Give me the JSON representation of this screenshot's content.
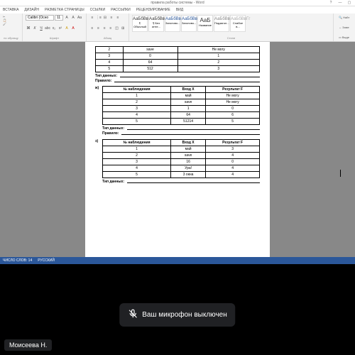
{
  "title": "правила работы системы - Word",
  "ribbonTabs": [
    "ВСТАВКА",
    "ДИЗАЙН",
    "РАЗМЕТКА СТРАНИЦЫ",
    "ССЫЛКИ",
    "РАССЫЛКИ",
    "РЕЦЕНЗИРОВАНИЕ",
    "ВИД"
  ],
  "font": {
    "name": "Calibri (Осно",
    "size": "11"
  },
  "groups": {
    "clipboard": "по образцу",
    "font": "Шрифт",
    "para": "Абзац",
    "styles": "Стили"
  },
  "styles": [
    {
      "t": "АаБбВвГг",
      "n": "¶ Обычный"
    },
    {
      "t": "АаБбВвГг",
      "n": "¶ Без инте..."
    },
    {
      "t": "АаБбВв",
      "n": "Заголово..."
    },
    {
      "t": "АаБбВвГ",
      "n": "Заголово..."
    },
    {
      "t": "АаБ",
      "n": "Название"
    },
    {
      "t": "АаБбВвГг",
      "n": "Подзагол..."
    },
    {
      "t": "АаБбВвГг",
      "n": "Слабое в..."
    }
  ],
  "editing": [
    "Найт",
    "Заме",
    "Выде"
  ],
  "doc": {
    "headers": {
      "num": "№ наблюдения",
      "x": "Вход X",
      "f": "Результат F"
    },
    "labels": {
      "type": "Тип данных:",
      "rule": "Правило:"
    },
    "table_top": [
      [
        "2",
        "save",
        "Не могу"
      ],
      [
        "3",
        "0",
        "1"
      ],
      [
        "4",
        "64",
        "2"
      ],
      [
        "5",
        "512",
        "3"
      ]
    ],
    "section_g": {
      "letter": "ж)",
      "rows": [
        [
          "1",
          "май",
          "Не могу"
        ],
        [
          "2",
          "save",
          "Не могу"
        ],
        [
          "3",
          "1",
          "0"
        ],
        [
          "4",
          "64",
          "6"
        ],
        [
          "5",
          "51214",
          "5"
        ]
      ]
    },
    "section_z": {
      "letter": "з)",
      "rows": [
        [
          "1",
          "май",
          "3"
        ],
        [
          "2",
          "save",
          "4"
        ],
        [
          "3",
          "16",
          "0"
        ],
        [
          "4",
          "Ура!",
          "4"
        ],
        [
          "5",
          "3 окна",
          "4"
        ]
      ]
    }
  },
  "status": {
    "words": "ЧИСЛО СЛОВ: 14",
    "lang": "РУССКИЙ"
  },
  "vc": {
    "toast": "Ваш микрофон выключен",
    "name": "Моисеева Н."
  }
}
